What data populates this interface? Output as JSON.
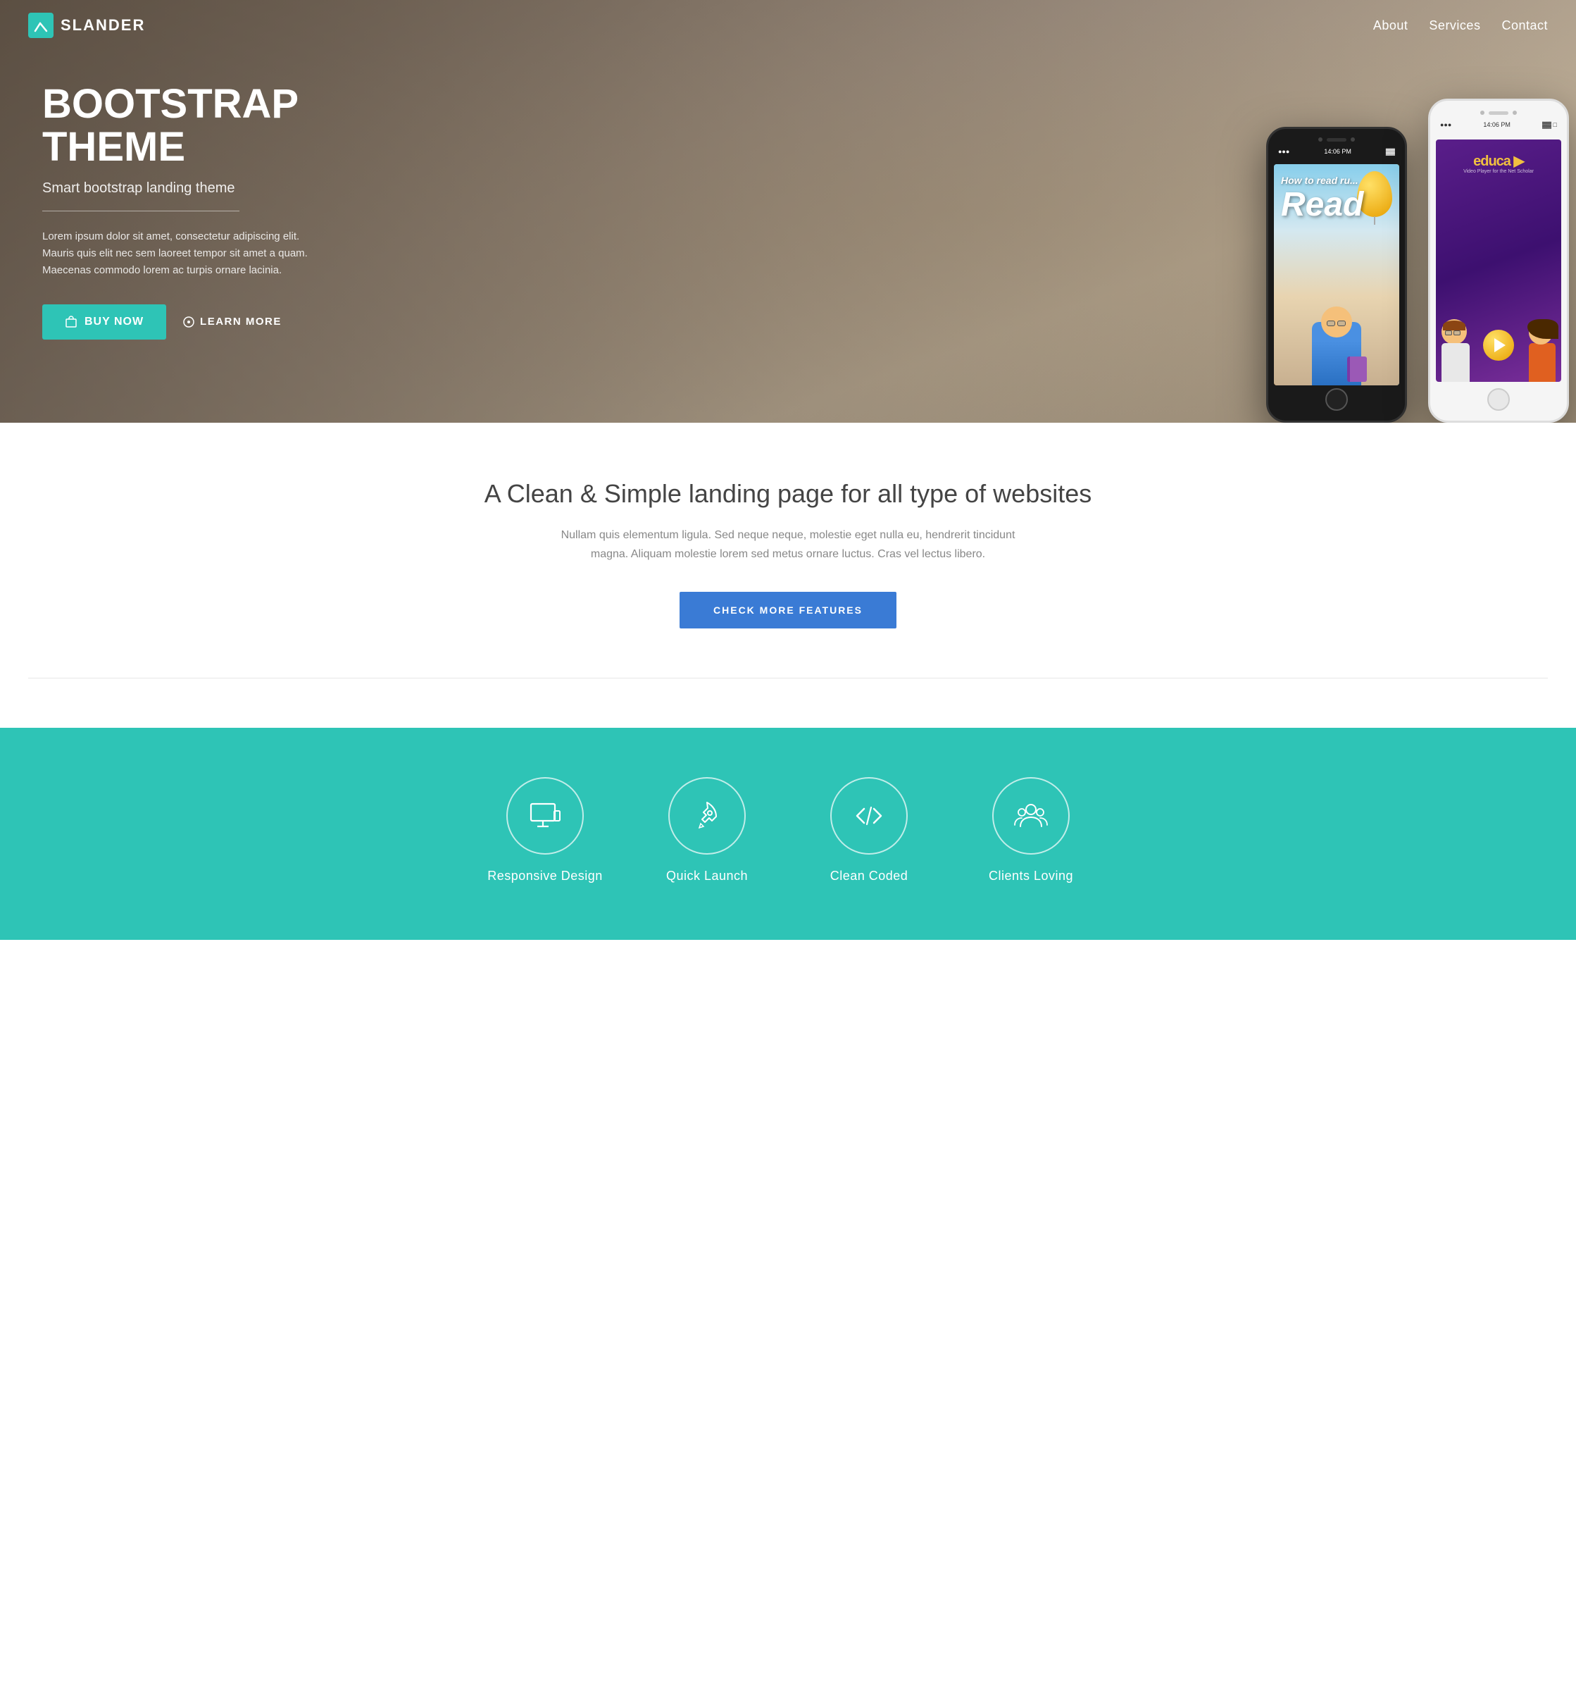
{
  "navbar": {
    "brand": "SLANDER",
    "nav_items": [
      {
        "label": "About",
        "href": "#about"
      },
      {
        "label": "Services",
        "href": "#services"
      },
      {
        "label": "Contact",
        "href": "#contact"
      }
    ]
  },
  "hero": {
    "title_line1": "BOOTSTRAP",
    "title_line2": "THEME",
    "subtitle": "Smart bootstrap landing theme",
    "description": "Lorem ipsum dolor sit amet, consectetur adipiscing elit. Mauris quis elit nec sem laoreet tempor sit amet a quam. Maecenas commodo lorem ac turpis ornare lacinia.",
    "btn_buy": "BUY NOW",
    "btn_learn": "LEARN MORE",
    "phone_time": "14:06 PM"
  },
  "features": {
    "title": "A Clean & Simple landing page for all type of websites",
    "description": "Nullam quis elementum ligula. Sed neque neque, molestie eget nulla eu, hendrerit tincidunt magna. Aliquam molestie lorem sed metus ornare luctus. Cras vel lectus libero.",
    "btn_label": "CHECK MORE FEATURES"
  },
  "teal_section": {
    "items": [
      {
        "label": "Responsive Design",
        "icon": "monitor"
      },
      {
        "label": "Quick Launch",
        "icon": "rocket"
      },
      {
        "label": "Clean Coded",
        "icon": "code"
      },
      {
        "label": "Clients Loving",
        "icon": "users"
      }
    ]
  }
}
